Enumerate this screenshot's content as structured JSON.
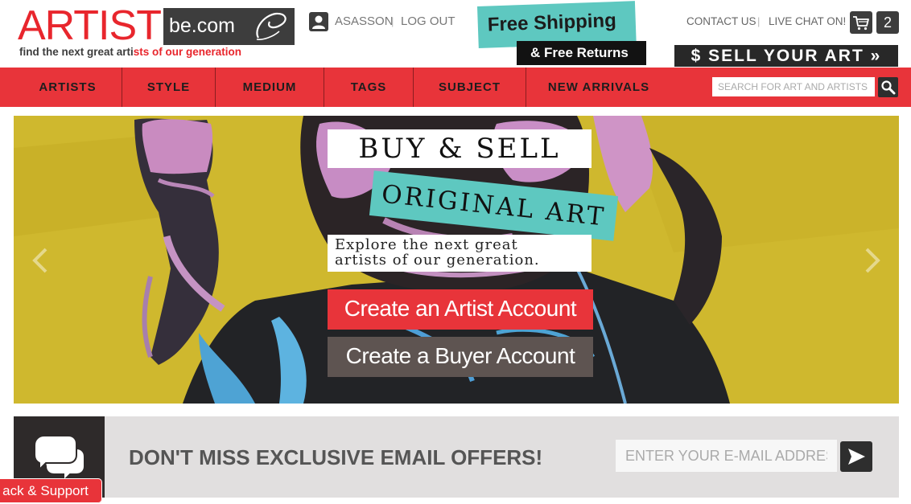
{
  "header": {
    "logo": {
      "artist": "ARTIST",
      "becom": "be.com",
      "tagline_part1": "find the next great arti",
      "tagline_part2": "sts of our generation"
    },
    "user": {
      "icon": "user-icon",
      "username": "ASASSON",
      "separator": "|",
      "logout_label": "LOG OUT"
    },
    "promo": {
      "free_shipping": "Free Shipping",
      "free_returns": "& Free Returns"
    },
    "links": {
      "contact": "CONTACT US",
      "separator": "|",
      "live_chat": "LIVE CHAT ON!"
    },
    "cart": {
      "icon": "cart-icon",
      "count": "2"
    },
    "sell_button": "$ SELL YOUR ART »"
  },
  "nav": {
    "items": [
      {
        "label": "ARTISTS"
      },
      {
        "label": "STYLE"
      },
      {
        "label": "MEDIUM"
      },
      {
        "label": "TAGS"
      },
      {
        "label": "SUBJECT"
      },
      {
        "label": "NEW ARRIVALS"
      }
    ],
    "search_placeholder": "SEARCH FOR ART AND ARTISTS",
    "search_icon": "search-icon"
  },
  "hero": {
    "buy_sell": "BUY & SELL",
    "original_art": "ORIGINAL ART",
    "explore": "Explore the next great artists of our generation.",
    "artist_account_button": "Create an Artist Account",
    "buyer_account_button": "Create a Buyer Account",
    "prev_icon": "chevron-left-icon",
    "next_icon": "chevron-right-icon"
  },
  "newsletter": {
    "icon": "chat-bubbles-icon",
    "headline": "DON'T MISS EXCLUSIVE EMAIL OFFERS!",
    "email_placeholder": "ENTER YOUR E-MAIL ADDRESS",
    "submit_icon": "send-arrow-icon"
  },
  "feedback_tab": "ack & Support",
  "colors": {
    "brand_red": "#e8343a",
    "teal": "#5ec8c0",
    "dark": "#2e2e2e",
    "hero_yellow": "#cfb62a",
    "newsletter_gray": "#e1dfdf"
  }
}
